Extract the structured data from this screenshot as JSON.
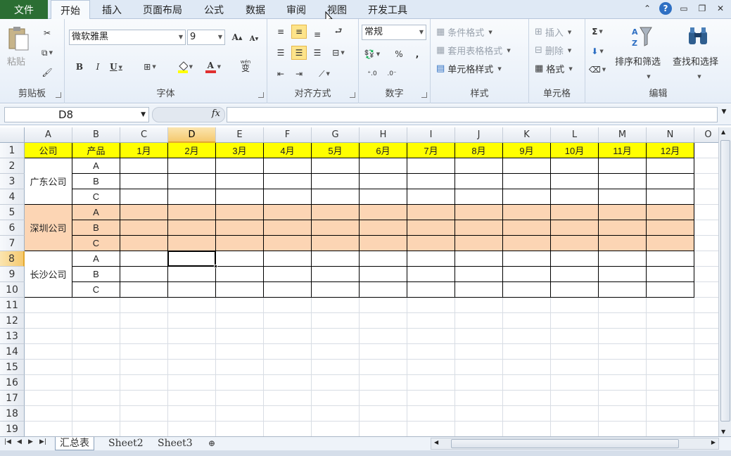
{
  "ribbon_tabs": [
    "文件",
    "开始",
    "插入",
    "页面布局",
    "公式",
    "数据",
    "审阅",
    "视图",
    "开发工具"
  ],
  "active_tab": "开始",
  "groups": {
    "clipboard": {
      "label": "剪贴板",
      "paste": "粘贴"
    },
    "font": {
      "label": "字体",
      "name": "微软雅黑",
      "size": "9",
      "bold": "B",
      "italic": "I",
      "underline": "U",
      "grow": "A",
      "shrink": "A",
      "text_color": "A",
      "wen": "wén",
      "bian": "变"
    },
    "align": {
      "label": "对齐方式"
    },
    "number": {
      "label": "数字",
      "format": "常规",
      "percent": "%",
      "comma": ","
    },
    "styles": {
      "label": "样式",
      "cond": "条件格式",
      "table": "套用表格格式",
      "cell": "单元格样式"
    },
    "cells": {
      "label": "单元格",
      "insert": "插入",
      "delete": "删除",
      "format": "格式"
    },
    "editing": {
      "label": "编辑",
      "sigma": "Σ",
      "sort": "排序和筛选",
      "find": "查找和选择"
    }
  },
  "formula_bar": {
    "name_box": "D8",
    "fx": "fx",
    "value": ""
  },
  "columns": [
    "A",
    "B",
    "C",
    "D",
    "E",
    "F",
    "G",
    "H",
    "I",
    "J",
    "K",
    "L",
    "M",
    "N",
    "O"
  ],
  "active_cell": {
    "col": "D",
    "row": 8
  },
  "rows": [
    1,
    2,
    3,
    4,
    5,
    6,
    7,
    8,
    9,
    10,
    11,
    12,
    13,
    14,
    15,
    16,
    17,
    18,
    19
  ],
  "table": {
    "header": [
      "公司",
      "产品",
      "1月",
      "2月",
      "3月",
      "4月",
      "5月",
      "6月",
      "7月",
      "8月",
      "9月",
      "10月",
      "11月",
      "12月"
    ],
    "groups": [
      {
        "company": "广东公司",
        "products": [
          "A",
          "B",
          "C"
        ],
        "fill": "#ffffff"
      },
      {
        "company": "深圳公司",
        "products": [
          "A",
          "B",
          "C"
        ],
        "fill": "#fcd5b4"
      },
      {
        "company": "长沙公司",
        "products": [
          "A",
          "B",
          "C"
        ],
        "fill": "#ffffff"
      }
    ],
    "header_fill": "#ffff00"
  },
  "sheets": [
    "汇总表",
    "Sheet2",
    "Sheet3"
  ],
  "active_sheet": "汇总表"
}
